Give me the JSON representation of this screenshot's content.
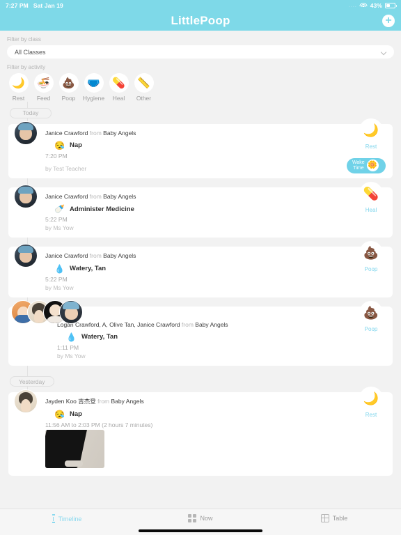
{
  "status_bar": {
    "time": "7:27 PM",
    "date": "Sat Jan 19",
    "signal_dots": "....",
    "wifi_icon": "wifi-icon",
    "battery_percent": "43%",
    "battery_icon": "battery-icon"
  },
  "nav": {
    "title": "LittlePoop",
    "add_icon": "+"
  },
  "filters": {
    "class_label": "Filter by class",
    "class_value": "All Classes",
    "class_chevron_icon": "chevron-down-icon",
    "activity_label": "Filter by activity",
    "activities": [
      {
        "name": "Rest",
        "glyph": "🌙",
        "icon": "moon-star-icon"
      },
      {
        "name": "Feed",
        "glyph": "🍜",
        "icon": "bowl-icon"
      },
      {
        "name": "Poop",
        "glyph": "💩",
        "icon": "poop-icon"
      },
      {
        "name": "Hygiene",
        "glyph": "🩲",
        "icon": "diaper-icon"
      },
      {
        "name": "Heal",
        "glyph": "💊",
        "icon": "medicine-bottle-icon"
      },
      {
        "name": "Other",
        "glyph": "📏",
        "icon": "ruler-icon"
      }
    ]
  },
  "timeline": {
    "day_today": "Today",
    "day_yesterday": "Yesterday",
    "cards": [
      {
        "who": "Janice Crawford",
        "from_word": "from",
        "class_name": "Baby Angels",
        "activity_glyph": "😪",
        "activity_icon": "sleepy-face-icon",
        "activity_text": "Nap",
        "time": "7:20 PM",
        "by": "by Test Teacher",
        "badge_glyph": "🌙",
        "badge_icon": "moon-star-icon",
        "badge_name": "Rest",
        "wake_line1": "Wake",
        "wake_line2": "Time",
        "wake_glyph": "🌼",
        "wake_icon": "sun-flower-icon"
      },
      {
        "who": "Janice Crawford",
        "from_word": "from",
        "class_name": "Baby Angels",
        "activity_glyph": "🍼",
        "activity_icon": "medicine-bottle-icon",
        "activity_text": "Administer Medicine",
        "time": "5:22 PM",
        "by": "by Ms Yow",
        "badge_glyph": "💊",
        "badge_icon": "medicine-bottle-icon",
        "badge_name": "Heal"
      },
      {
        "who": "Janice Crawford",
        "from_word": "from",
        "class_name": "Baby Angels",
        "activity_glyph": "💧",
        "activity_icon": "droplet-icon",
        "activity_text": "Watery, Tan",
        "time": "5:22 PM",
        "by": "by Ms Yow",
        "badge_glyph": "💩",
        "badge_icon": "poop-icon",
        "badge_name": "Poop"
      },
      {
        "who": "Logan Crawford, A, Olive Tan, Janice Crawford",
        "from_word": "from",
        "class_name": "Baby Angels",
        "activity_glyph": "💧",
        "activity_icon": "droplet-icon",
        "activity_text": "Watery, Tan",
        "time": "1:11 PM",
        "by": "by Ms Yow",
        "badge_glyph": "💩",
        "badge_icon": "poop-icon",
        "badge_name": "Poop"
      },
      {
        "who": "Jayden Koo 吉杰登",
        "from_word": "from",
        "class_name": "Baby Angels",
        "activity_glyph": "😪",
        "activity_icon": "sleepy-face-icon",
        "activity_text": "Nap",
        "time": "11:56 AM to 2:03 PM (2 hours 7 minutes)",
        "by": "",
        "badge_glyph": "🌙",
        "badge_icon": "moon-star-icon",
        "badge_name": "Rest"
      }
    ]
  },
  "tabbar": {
    "tabs": [
      {
        "label": "Timeline",
        "icon": "timeline-icon",
        "active": true
      },
      {
        "label": "Now",
        "icon": "grid-icon",
        "active": false
      },
      {
        "label": "Table",
        "icon": "table-icon",
        "active": false
      }
    ]
  },
  "colors": {
    "brand": "#7ed9e8",
    "accent_text": "#7fd5ec",
    "page_bg": "#f2f2f2",
    "card_bg": "#ffffff"
  }
}
